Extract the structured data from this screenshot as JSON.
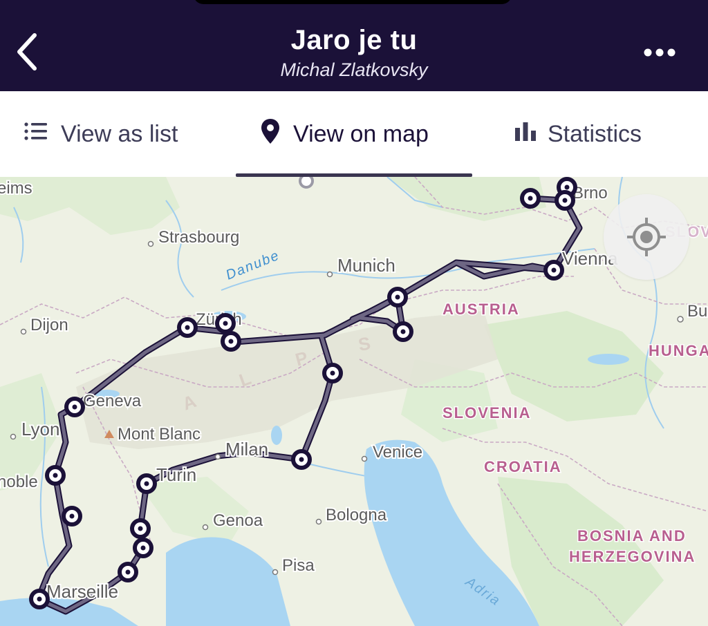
{
  "header": {
    "title": "Jaro je tu",
    "subtitle": "Michal Zlatkovsky",
    "back_icon": "chevron-left-icon",
    "more_icon": "more-horizontal-icon",
    "background_color": "#1b1138"
  },
  "tabs": [
    {
      "label": "View as list",
      "icon": "list-icon",
      "active": false
    },
    {
      "label": "View on map",
      "icon": "map-pin-icon",
      "active": true
    },
    {
      "label": "Statistics",
      "icon": "bar-chart-icon",
      "active": false
    }
  ],
  "map": {
    "locate_icon": "crosshair-icon",
    "cities": [
      {
        "name": "eims"
      },
      {
        "name": "Strasbourg"
      },
      {
        "name": "Munich"
      },
      {
        "name": "Brno"
      },
      {
        "name": "Vienna"
      },
      {
        "name": "Dijon"
      },
      {
        "name": "Zürich"
      },
      {
        "name": "Geneva"
      },
      {
        "name": "Lyon"
      },
      {
        "name": "Mont Blanc"
      },
      {
        "name": "Milan"
      },
      {
        "name": "Venice"
      },
      {
        "name": "Turin"
      },
      {
        "name": "noble"
      },
      {
        "name": "Genoa"
      },
      {
        "name": "Bologna"
      },
      {
        "name": "Pisa"
      },
      {
        "name": "Marseille"
      },
      {
        "name": "Bu"
      }
    ],
    "countries": [
      {
        "name": "AUSTRIA"
      },
      {
        "name": "SLOVENIA"
      },
      {
        "name": "CROATIA"
      },
      {
        "name": "HUNGA"
      },
      {
        "name": "BOSNIA AND"
      },
      {
        "name": "HERZEGOVINA"
      },
      {
        "name": "SLOV"
      }
    ],
    "features": [
      {
        "name": "Danube"
      },
      {
        "name": "A"
      },
      {
        "name": "L"
      },
      {
        "name": "P"
      },
      {
        "name": "S"
      },
      {
        "name": "Adria"
      }
    ],
    "colors": {
      "land": "#eef1e4",
      "green": "#d8ebcc",
      "water": "#a9d5f2",
      "route": "#6e6784",
      "route_outline": "#1b1138",
      "marker": "#1b1138",
      "country_label": "#b85f8f",
      "city_label": "#5b5b5b"
    }
  }
}
